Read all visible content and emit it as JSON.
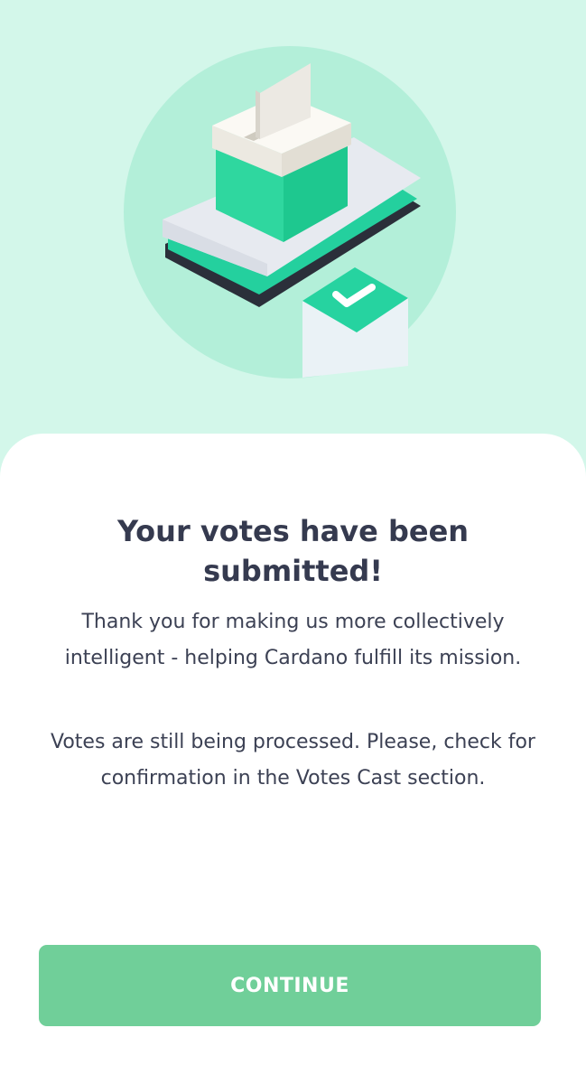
{
  "illustration": {
    "icon": "ballot-box-phone-illustration",
    "check_icon": "checkmark-icon"
  },
  "confirmation": {
    "title": "Your votes have been submitted!",
    "message": "Thank you for making us more collectively intelligent - helping Cardano fulfill its mission.",
    "note": "Votes are still being processed. Please, check for confirmation in the Votes Cast section."
  },
  "actions": {
    "continue_label": "CONTINUE"
  },
  "colors": {
    "background_mint": "#d3f7ea",
    "circle_mint": "#b3efd9",
    "accent_green": "#1fd49c",
    "button_green": "#70cf99",
    "text_dark": "#353a4f"
  }
}
